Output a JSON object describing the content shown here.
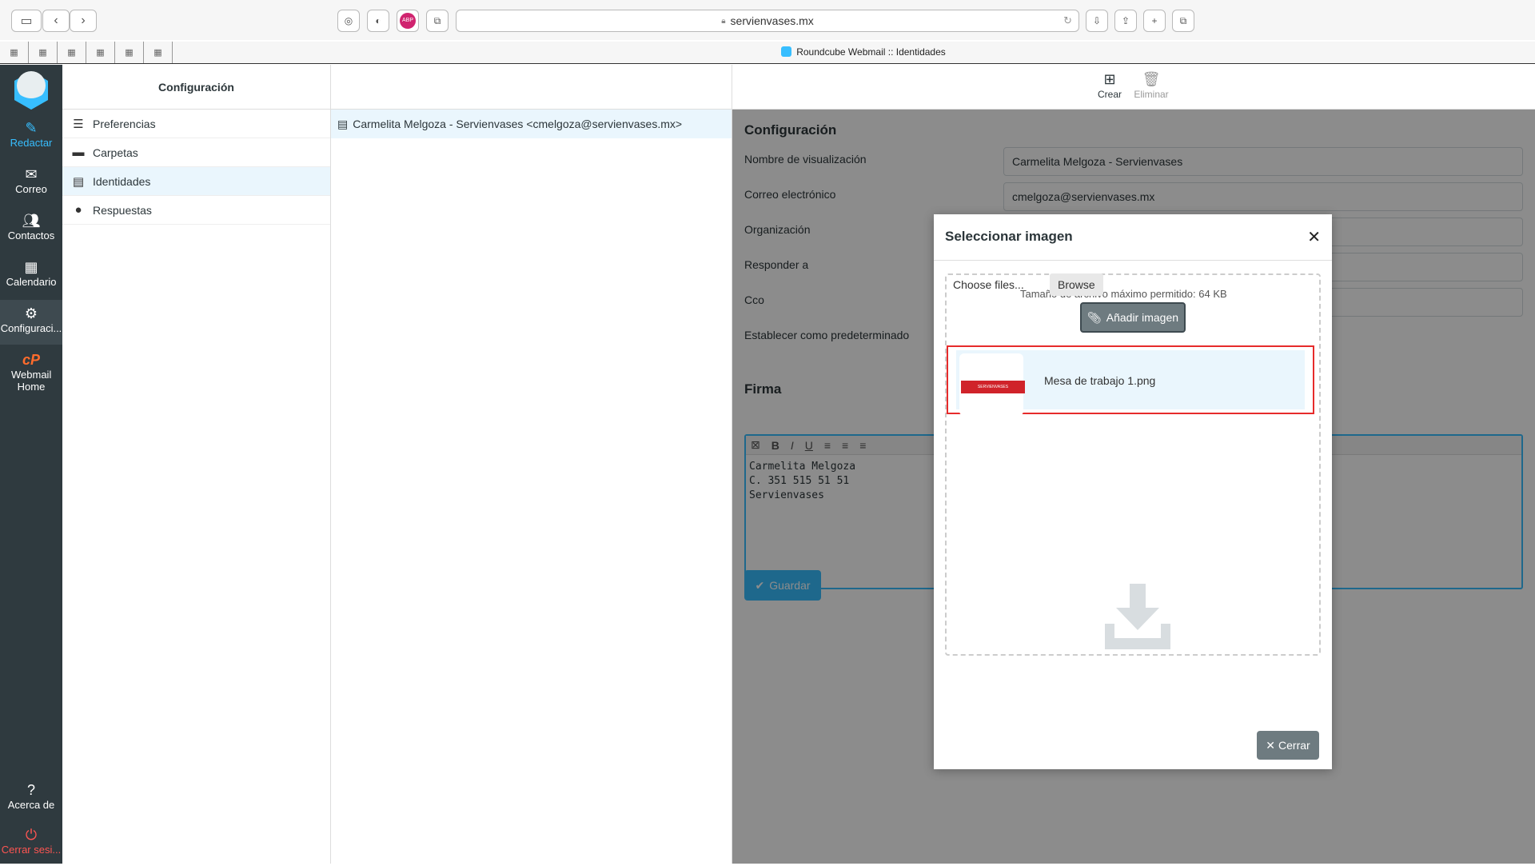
{
  "browser": {
    "url": "servienvases.mx",
    "tab_title": "Roundcube Webmail :: Identidades",
    "ext_adblock": "ABP"
  },
  "appnav": {
    "items": [
      {
        "label": "Redactar",
        "icon": "compose-icon"
      },
      {
        "label": "Correo",
        "icon": "mail-icon"
      },
      {
        "label": "Contactos",
        "icon": "contacts-icon"
      },
      {
        "label": "Calendario",
        "icon": "calendar-icon"
      },
      {
        "label": "Configuraci...",
        "icon": "gear-icon"
      },
      {
        "label": "Webmail Home",
        "icon": "cpanel-icon",
        "icon_text": "cP"
      },
      {
        "label": "Acerca de",
        "icon": "help-icon"
      },
      {
        "label": "Cerrar sesi...",
        "icon": "power-icon"
      }
    ]
  },
  "settings": {
    "title": "Configuración",
    "items": [
      {
        "label": "Preferencias"
      },
      {
        "label": "Carpetas"
      },
      {
        "label": "Identidades"
      },
      {
        "label": "Respuestas"
      }
    ]
  },
  "identities": {
    "row": "Carmelita Melgoza - Servienvases <cmelgoza@servienvases.mx>"
  },
  "toolbar": {
    "create": "Crear",
    "delete": "Eliminar"
  },
  "form": {
    "section_title": "Configuración",
    "fields": [
      {
        "label": "Nombre de visualización",
        "value": "Carmelita Melgoza - Servienvases"
      },
      {
        "label": "Correo electrónico",
        "value": "cmelgoza@servienvases.mx"
      },
      {
        "label": "Organización",
        "value": ""
      },
      {
        "label": "Responder a",
        "value": ""
      },
      {
        "label": "Cco",
        "value": ""
      },
      {
        "label": "Establecer como predeterminado",
        "value": ""
      }
    ],
    "signature_title": "Firma",
    "signature_text": "Carmelita Melgoza\nC. 351 515 51 51\nServienvases",
    "save": "Guardar"
  },
  "dialog": {
    "title": "Seleccionar imagen",
    "choose_files": "Choose files...",
    "browse": "Browse",
    "max_size": "Tamaño de archivo máximo permitido: 64 KB",
    "add_image": "Añadir imagen",
    "file_name": "Mesa de trabajo 1.png",
    "thumb_text": "SERVIENVASES",
    "close": "Cerrar"
  },
  "colors": {
    "accent": "#37beff",
    "nav_bg": "#2f3a3f",
    "highlight": "#e62b2b"
  }
}
